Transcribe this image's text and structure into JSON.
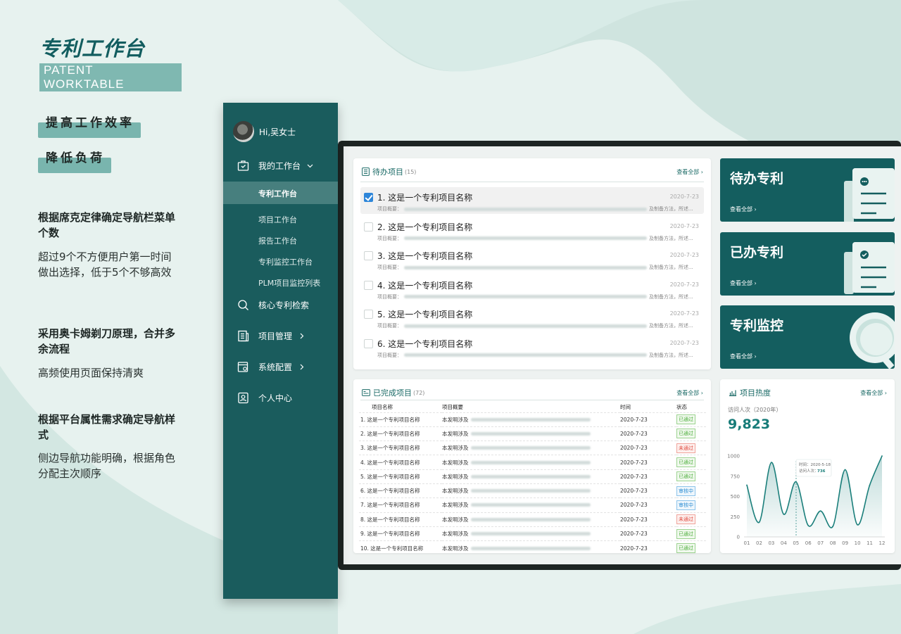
{
  "brand": {
    "title": "专利工作台",
    "subtitle": "PATENT WORKTABLE"
  },
  "pills": [
    "提高工作效率",
    "降低负荷"
  ],
  "notes": [
    {
      "heading": "根据席克定律确定导航栏菜单个数",
      "body": "超过9个不方便用户第一时间做出选择，低于5个不够高效"
    },
    {
      "heading": "采用奥卡姆剃刀原理，合并多余流程",
      "body": "高频使用页面保持清爽"
    },
    {
      "heading": "根据平台属性需求确定导航样式",
      "body": "侧边导航功能明确，根据角色分配主次顺序"
    }
  ],
  "sidebar": {
    "user": "Hi,吴女士",
    "workbench": "我的工作台",
    "sub_items": [
      "专利工作台",
      "项目工作台",
      "报告工作台",
      "专利监控工作台",
      "PLM项目监控列表"
    ],
    "search": "核心专利检索",
    "project": "项目管理",
    "system": "系统配置",
    "personal": "个人中心"
  },
  "todo": {
    "title": "待办项目",
    "count": "(15)",
    "see_all": "查看全部 ›",
    "desc_label": "项目概要：",
    "desc_tail": "及制备方法，所述...",
    "items": [
      {
        "title": "1. 这是一个专利项目名称",
        "date": "2020-7-23",
        "checked": true
      },
      {
        "title": "2. 这是一个专利项目名称",
        "date": "2020-7-23",
        "checked": false
      },
      {
        "title": "3. 这是一个专利项目名称",
        "date": "2020-7-23",
        "checked": false
      },
      {
        "title": "4. 这是一个专利项目名称",
        "date": "2020-7-23",
        "checked": false
      },
      {
        "title": "5. 这是一个专利项目名称",
        "date": "2020-7-23",
        "checked": false
      },
      {
        "title": "6. 这是一个专利项目名称",
        "date": "2020-7-23",
        "checked": false
      }
    ]
  },
  "tiles": [
    {
      "title": "待办专利",
      "link": "查看全部 ›"
    },
    {
      "title": "已办专利",
      "link": "查看全部 ›"
    },
    {
      "title": "专利监控",
      "link": "查看全部 ›"
    }
  ],
  "done": {
    "title": "已完成项目",
    "count": "(72)",
    "see_all": "查看全部 ›",
    "columns": [
      "项目名称",
      "项目概要",
      "时间",
      "状态"
    ],
    "summary_prefix": "本发明涉及",
    "rows": [
      {
        "name": "1. 这是一个专利项目名称",
        "date": "2020-7-23",
        "status": "已通过",
        "type": "ok"
      },
      {
        "name": "2. 这是一个专利项目名称",
        "date": "2020-7-23",
        "status": "已通过",
        "type": "ok"
      },
      {
        "name": "3. 这是一个专利项目名称",
        "date": "2020-7-23",
        "status": "未通过",
        "type": "no"
      },
      {
        "name": "4. 这是一个专利项目名称",
        "date": "2020-7-23",
        "status": "已通过",
        "type": "ok"
      },
      {
        "name": "5. 这是一个专利项目名称",
        "date": "2020-7-23",
        "status": "已通过",
        "type": "ok"
      },
      {
        "name": "6. 这是一个专利项目名称",
        "date": "2020-7-23",
        "status": "审核中",
        "type": "rv"
      },
      {
        "name": "7. 这是一个专利项目名称",
        "date": "2020-7-23",
        "status": "审核中",
        "type": "rv"
      },
      {
        "name": "8. 这是一个专利项目名称",
        "date": "2020-7-23",
        "status": "未通过",
        "type": "no"
      },
      {
        "name": "9. 这是一个专利项目名称",
        "date": "2020-7-23",
        "status": "已通过",
        "type": "ok"
      },
      {
        "name": "10. 这是一个专利项目名称",
        "date": "2020-7-23",
        "status": "已通过",
        "type": "ok"
      }
    ]
  },
  "heat": {
    "title": "项目热度",
    "see_all": "查看全部 ›",
    "subtitle": "访问人次（2020年）",
    "value": "9,823",
    "tooltip_time": "时间：2020-5-18",
    "tooltip_label": "访问人次：",
    "tooltip_value": "736"
  },
  "chart_data": {
    "type": "area",
    "categories": [
      "01",
      "02",
      "03",
      "04",
      "05",
      "06",
      "07",
      "08",
      "09",
      "10",
      "11",
      "12"
    ],
    "values": [
      640,
      180,
      920,
      280,
      680,
      140,
      320,
      130,
      830,
      150,
      640,
      1000
    ],
    "ylim": [
      0,
      1000
    ],
    "yticks": [
      0,
      250,
      500,
      750,
      1000
    ],
    "grid": false,
    "color": "#1b7f7b"
  },
  "colors": {
    "primary": "#1a5c5d",
    "accent": "#177c79",
    "check": "#2e86d9"
  }
}
